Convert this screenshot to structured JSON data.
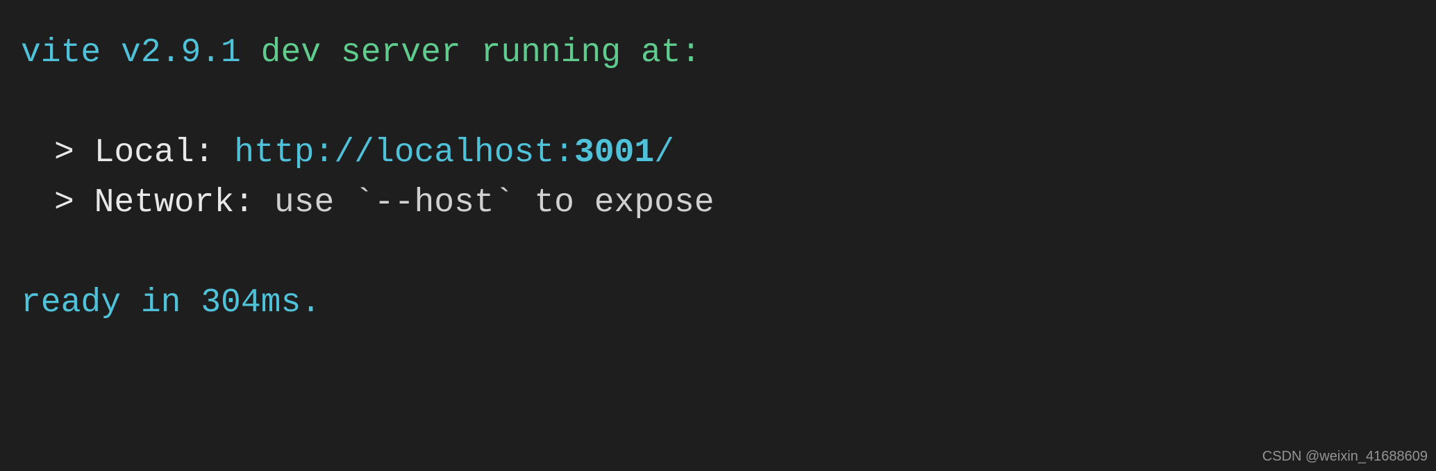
{
  "header": {
    "tool": "vite v2.9.1",
    "message": " dev server running at:"
  },
  "local": {
    "prefix": "> ",
    "label": "Local: ",
    "scheme_host": "http://localhost:",
    "port": "3001",
    "path": "/"
  },
  "network": {
    "prefix": "> ",
    "label": "Network: ",
    "hint": "use `--host` to expose"
  },
  "ready": {
    "text": "ready in 304ms."
  },
  "watermark": "CSDN @weixin_41688609"
}
